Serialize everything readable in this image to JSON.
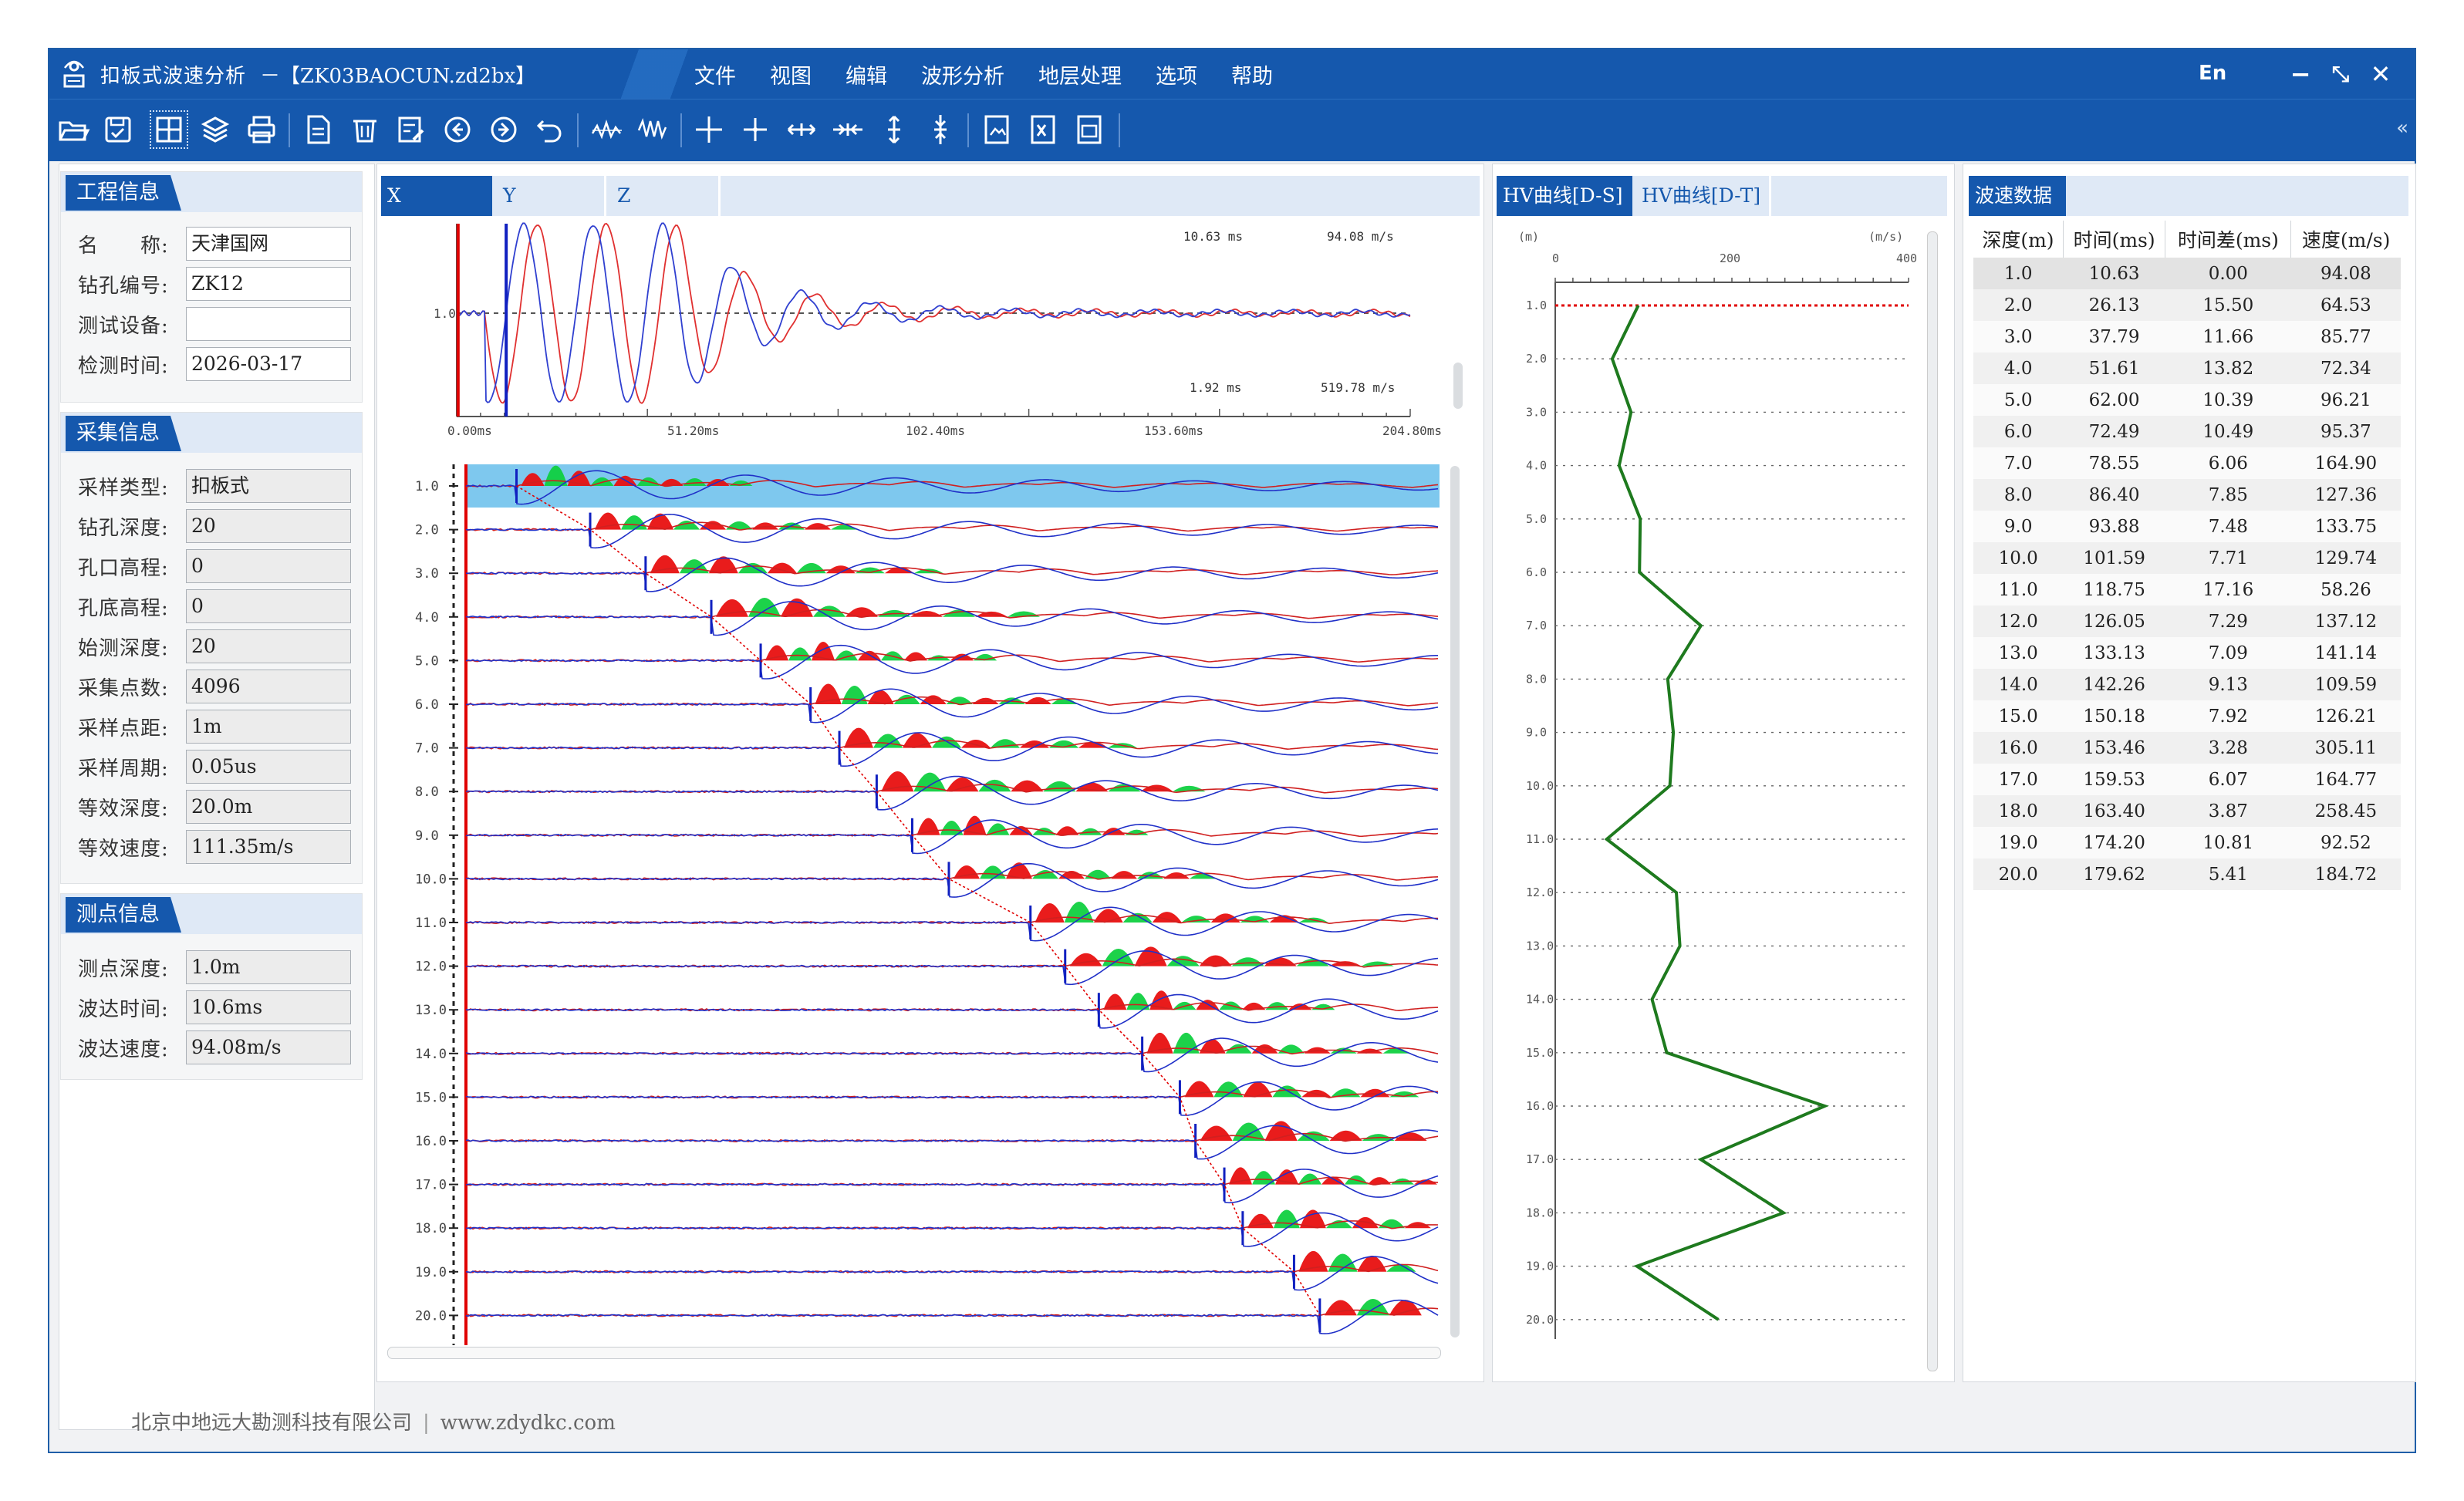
{
  "app": {
    "title": "扣板式波速分析",
    "file": "－【ZK03BAOCUN.zd2bx】",
    "menu": [
      "文件",
      "视图",
      "编辑",
      "波形分析",
      "地层处理",
      "选项",
      "帮助"
    ],
    "lang": "En"
  },
  "project_info": {
    "title": "工程信息",
    "fields": [
      {
        "label": "名　　称:",
        "value": "天津国网"
      },
      {
        "label": "钻孔编号:",
        "value": "ZK12"
      },
      {
        "label": "测试设备:",
        "value": ""
      },
      {
        "label": "检测时间:",
        "value": "2026-03-17"
      }
    ]
  },
  "acquisition_info": {
    "title": "采集信息",
    "fields": [
      {
        "label": "采样类型:",
        "value": "扣板式"
      },
      {
        "label": "钻孔深度:",
        "value": "20"
      },
      {
        "label": "孔口高程:",
        "value": "0"
      },
      {
        "label": "孔底高程:",
        "value": "0"
      },
      {
        "label": "始测深度:",
        "value": "20"
      },
      {
        "label": "采集点数:",
        "value": "4096"
      },
      {
        "label": "采样点距:",
        "value": "1m"
      },
      {
        "label": "采样周期:",
        "value": "0.05us"
      },
      {
        "label": "等效深度:",
        "value": "20.0m"
      },
      {
        "label": "等效速度:",
        "value": "111.35m/s"
      }
    ]
  },
  "point_info": {
    "title": "测点信息",
    "fields": [
      {
        "label": "测点深度:",
        "value": "1.0m"
      },
      {
        "label": "波达时间:",
        "value": "10.6ms"
      },
      {
        "label": "波达速度:",
        "value": "94.08m/s"
      }
    ]
  },
  "wave_tabs": [
    "X",
    "Y",
    "Z"
  ],
  "wave_top": {
    "readout_time1": "10.63 ms",
    "readout_vel1": "94.08 m/s",
    "readout_time2": "1.92 ms",
    "readout_vel2": "519.78 m/s",
    "trace_label": "1.0",
    "x_ticks": [
      "0.00ms",
      "51.20ms",
      "102.40ms",
      "153.60ms",
      "204.80ms"
    ]
  },
  "wave_main": {
    "depth_labels": [
      "1.0",
      "2.0",
      "3.0",
      "4.0",
      "5.0",
      "6.0",
      "7.0",
      "8.0",
      "9.0",
      "10.0",
      "11.0",
      "12.0",
      "13.0",
      "14.0",
      "15.0",
      "16.0",
      "17.0",
      "18.0",
      "19.0",
      "20.0"
    ],
    "pick_times_ms": [
      10.63,
      26.13,
      37.79,
      51.61,
      62.0,
      72.49,
      78.55,
      86.4,
      93.88,
      101.59,
      118.75,
      126.05,
      133.13,
      142.26,
      150.18,
      153.46,
      159.53,
      163.4,
      174.2,
      179.62
    ],
    "x_max_ms": 204.8
  },
  "hv_tabs": [
    "HV曲线[D-S]",
    "HV曲线[D-T]"
  ],
  "hv_chart": {
    "y_unit": "(m)",
    "x_unit": "(m/s)",
    "x_ticks": [
      "0",
      "200",
      "400"
    ],
    "x_range": [
      0,
      400
    ],
    "depths": [
      1,
      2,
      3,
      4,
      5,
      6,
      7,
      8,
      9,
      10,
      11,
      12,
      13,
      14,
      15,
      16,
      17,
      18,
      19,
      20
    ],
    "depth_labels": [
      "1.0",
      "2.0",
      "3.0",
      "4.0",
      "5.0",
      "6.0",
      "7.0",
      "8.0",
      "9.0",
      "10.0",
      "11.0",
      "12.0",
      "13.0",
      "14.0",
      "15.0",
      "16.0",
      "17.0",
      "18.0",
      "19.0",
      "20.0"
    ],
    "velocities": [
      94.08,
      64.53,
      85.77,
      72.34,
      96.21,
      95.37,
      164.9,
      127.36,
      133.75,
      129.74,
      58.26,
      137.12,
      141.14,
      109.59,
      126.21,
      305.11,
      164.77,
      258.45,
      92.52,
      184.72
    ],
    "line_color": "#1e7a1e",
    "marker_color": "#e00000"
  },
  "wave_data": {
    "title": "波速数据",
    "headers": [
      "深度(m)",
      "时间(ms)",
      "时间差(ms)",
      "速度(m/s)"
    ],
    "rows": [
      [
        "1.0",
        "10.63",
        "0.00",
        "94.08"
      ],
      [
        "2.0",
        "26.13",
        "15.50",
        "64.53"
      ],
      [
        "3.0",
        "37.79",
        "11.66",
        "85.77"
      ],
      [
        "4.0",
        "51.61",
        "13.82",
        "72.34"
      ],
      [
        "5.0",
        "62.00",
        "10.39",
        "96.21"
      ],
      [
        "6.0",
        "72.49",
        "10.49",
        "95.37"
      ],
      [
        "7.0",
        "78.55",
        "6.06",
        "164.90"
      ],
      [
        "8.0",
        "86.40",
        "7.85",
        "127.36"
      ],
      [
        "9.0",
        "93.88",
        "7.48",
        "133.75"
      ],
      [
        "10.0",
        "101.59",
        "7.71",
        "129.74"
      ],
      [
        "11.0",
        "118.75",
        "17.16",
        "58.26"
      ],
      [
        "12.0",
        "126.05",
        "7.29",
        "137.12"
      ],
      [
        "13.0",
        "133.13",
        "7.09",
        "141.14"
      ],
      [
        "14.0",
        "142.26",
        "9.13",
        "109.59"
      ],
      [
        "15.0",
        "150.18",
        "7.92",
        "126.21"
      ],
      [
        "16.0",
        "153.46",
        "3.28",
        "305.11"
      ],
      [
        "17.0",
        "159.53",
        "6.07",
        "164.77"
      ],
      [
        "18.0",
        "163.40",
        "3.87",
        "258.45"
      ],
      [
        "19.0",
        "174.20",
        "10.81",
        "92.52"
      ],
      [
        "20.0",
        "179.62",
        "5.41",
        "184.72"
      ]
    ]
  },
  "footer": {
    "company": "北京中地远大勘测科技有限公司",
    "url": "www.zdydkc.com"
  }
}
